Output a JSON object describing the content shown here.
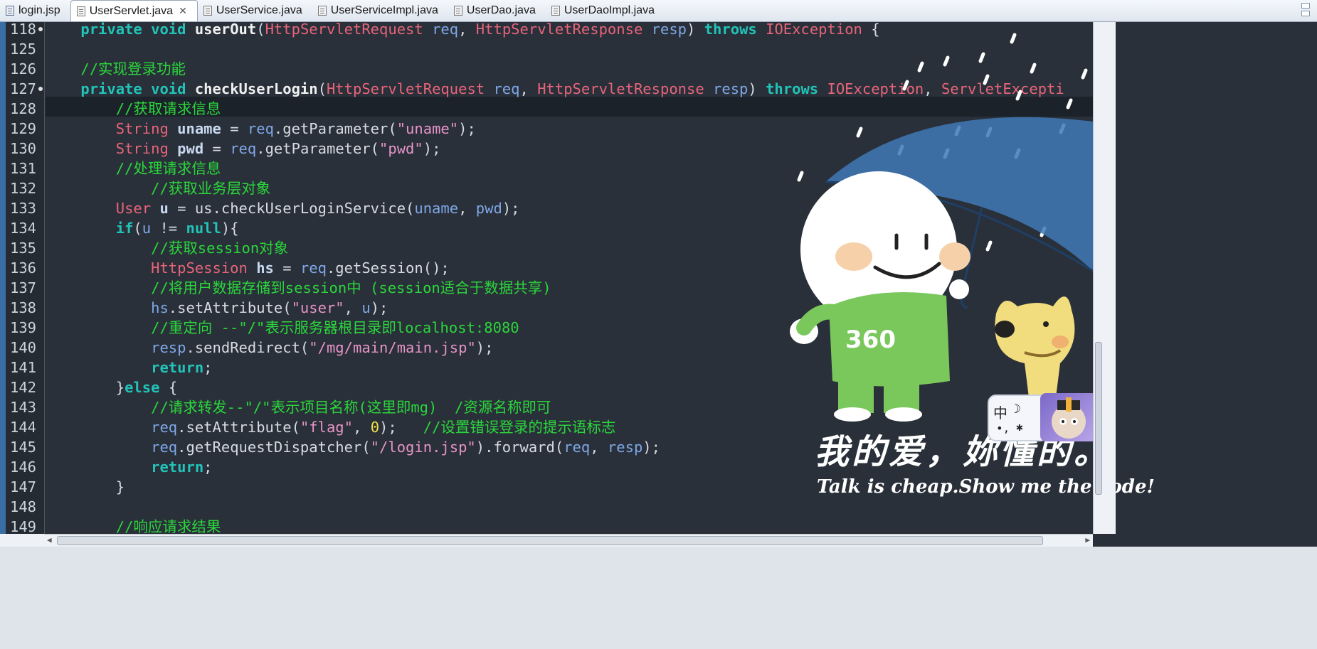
{
  "tabs": [
    {
      "label": "login.jsp",
      "active": false,
      "icon": "jsp-file-icon"
    },
    {
      "label": "UserServlet.java",
      "active": true,
      "icon": "java-file-icon",
      "close": "✕"
    },
    {
      "label": "UserService.java",
      "active": false,
      "icon": "java-file-icon"
    },
    {
      "label": "UserServiceImpl.java",
      "active": false,
      "icon": "java-file-icon"
    },
    {
      "label": "UserDao.java",
      "active": false,
      "icon": "java-file-icon"
    },
    {
      "label": "UserDaoImpl.java",
      "active": false,
      "icon": "java-file-icon"
    }
  ],
  "editor": {
    "line_numbers": [
      "118",
      "125",
      "126",
      "127",
      "128",
      "129",
      "130",
      "131",
      "132",
      "133",
      "134",
      "135",
      "136",
      "137",
      "138",
      "139",
      "140",
      "141",
      "142",
      "143",
      "144",
      "145",
      "146",
      "147",
      "148",
      "149"
    ],
    "lines": [
      [
        [
          "k",
          "    private void "
        ],
        [
          "m",
          "userOut"
        ],
        [
          "p",
          "("
        ],
        [
          "t",
          "HttpServletRequest "
        ],
        [
          "v",
          "req"
        ],
        [
          "p",
          ", "
        ],
        [
          "t",
          "HttpServletResponse "
        ],
        [
          "v",
          "resp"
        ],
        [
          "p",
          ") "
        ],
        [
          "k",
          "throws "
        ],
        [
          "t",
          "IOException "
        ],
        [
          "p",
          "{"
        ]
      ],
      [],
      [
        [
          "c",
          "    //实现登录功能"
        ]
      ],
      [
        [
          "k",
          "    private void "
        ],
        [
          "m",
          "checkUserLogin"
        ],
        [
          "p",
          "("
        ],
        [
          "t",
          "HttpServletRequest "
        ],
        [
          "v",
          "req"
        ],
        [
          "p",
          ", "
        ],
        [
          "t",
          "HttpServletResponse "
        ],
        [
          "v",
          "resp"
        ],
        [
          "p",
          ") "
        ],
        [
          "k",
          "throws "
        ],
        [
          "t",
          "IOException"
        ],
        [
          "p",
          ", "
        ],
        [
          "t",
          "ServletExcepti"
        ]
      ],
      [
        [
          "c",
          "        //获取请求信息"
        ]
      ],
      [
        [
          "t",
          "        String "
        ],
        [
          "lv",
          "uname"
        ],
        [
          "p",
          " = "
        ],
        [
          "v",
          "req"
        ],
        [
          "p",
          ".getParameter("
        ],
        [
          "s",
          "\"uname\""
        ],
        [
          "p",
          ");"
        ]
      ],
      [
        [
          "t",
          "        String "
        ],
        [
          "lv",
          "pwd"
        ],
        [
          "p",
          " = "
        ],
        [
          "v",
          "req"
        ],
        [
          "p",
          ".getParameter("
        ],
        [
          "s",
          "\"pwd\""
        ],
        [
          "p",
          ");"
        ]
      ],
      [
        [
          "c",
          "        //处理请求信息"
        ]
      ],
      [
        [
          "c",
          "            //获取业务层对象"
        ]
      ],
      [
        [
          "t",
          "        User "
        ],
        [
          "lv",
          "u"
        ],
        [
          "p",
          " = us.checkUserLoginService("
        ],
        [
          "v",
          "uname"
        ],
        [
          "p",
          ", "
        ],
        [
          "v",
          "pwd"
        ],
        [
          "p",
          ");"
        ]
      ],
      [
        [
          "k",
          "        if"
        ],
        [
          "p",
          "("
        ],
        [
          "v",
          "u"
        ],
        [
          "p",
          " != "
        ],
        [
          "k",
          "null"
        ],
        [
          "p",
          "){"
        ]
      ],
      [
        [
          "c",
          "            //获取session对象"
        ]
      ],
      [
        [
          "t",
          "            HttpSession "
        ],
        [
          "lv",
          "hs"
        ],
        [
          "p",
          " = "
        ],
        [
          "v",
          "req"
        ],
        [
          "p",
          ".getSession();"
        ]
      ],
      [
        [
          "c",
          "            //将用户数据存储到session中 (session适合于数据共享)"
        ]
      ],
      [
        [
          "v",
          "            hs"
        ],
        [
          "p",
          ".setAttribute("
        ],
        [
          "s",
          "\"user\""
        ],
        [
          "p",
          ", "
        ],
        [
          "v",
          "u"
        ],
        [
          "p",
          ");"
        ]
      ],
      [
        [
          "c",
          "            //重定向 --\"/\"表示服务器根目录即localhost:8080"
        ]
      ],
      [
        [
          "v",
          "            resp"
        ],
        [
          "p",
          ".sendRedirect("
        ],
        [
          "s",
          "\"/mg/main/main.jsp\""
        ],
        [
          "p",
          ");"
        ]
      ],
      [
        [
          "k",
          "            return"
        ],
        [
          "p",
          ";"
        ]
      ],
      [
        [
          "p",
          "        }"
        ],
        [
          "k",
          "else "
        ],
        [
          "p",
          "{"
        ]
      ],
      [
        [
          "c",
          "            //请求转发--\"/\"表示项目名称(这里即mg)  /资源名称即可"
        ]
      ],
      [
        [
          "v",
          "            req"
        ],
        [
          "p",
          ".setAttribute("
        ],
        [
          "s",
          "\"flag\""
        ],
        [
          "p",
          ", "
        ],
        [
          "n",
          "0"
        ],
        [
          "p",
          ");   "
        ],
        [
          "c",
          "//设置错误登录的提示语标志"
        ]
      ],
      [
        [
          "v",
          "            req"
        ],
        [
          "p",
          ".getRequestDispatcher("
        ],
        [
          "s",
          "\"/login.jsp\""
        ],
        [
          "p",
          ").forward("
        ],
        [
          "v",
          "req"
        ],
        [
          "p",
          ", "
        ],
        [
          "v",
          "resp"
        ],
        [
          "p",
          ");"
        ]
      ],
      [
        [
          "k",
          "            return"
        ],
        [
          "p",
          ";"
        ]
      ],
      [
        [
          "p",
          "        }"
        ]
      ],
      [],
      [
        [
          "c",
          "        //响应请求结果"
        ]
      ]
    ]
  },
  "background_art": {
    "slogan_cn": "我的爱，妳懂的。",
    "slogan_en": "Talk is cheap.Show me the code!",
    "shirt_text": "360"
  },
  "ime": {
    "label": "中",
    "moon": "☽",
    "dot": "•,",
    "mode_icon": "butterfly-icon"
  },
  "colors": {
    "editor_bg": "#293039",
    "keyword": "#22c3b8",
    "type": "#e8647a",
    "comment": "#2bd63c",
    "string": "#e694c8",
    "variable": "#7fa8e8"
  }
}
